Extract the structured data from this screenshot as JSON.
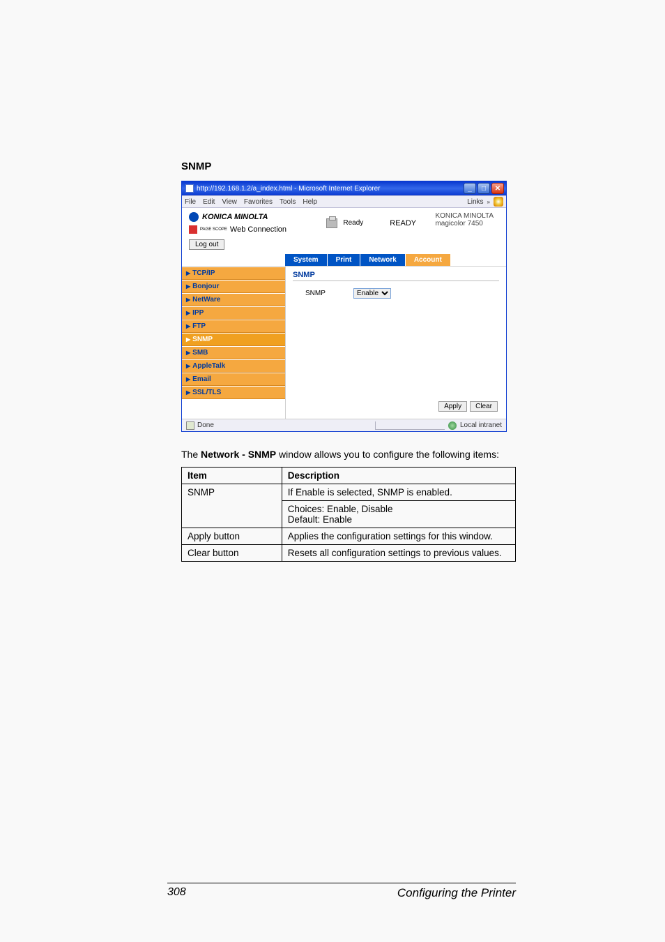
{
  "section_heading": "SNMP",
  "ie_window": {
    "title": "http://192.168.1.2/a_index.html - Microsoft Internet Explorer",
    "menubar": [
      "File",
      "Edit",
      "View",
      "Favorites",
      "Tools",
      "Help"
    ],
    "links_label": "Links",
    "brand": "KONICA MINOLTA",
    "webconn_prefix": "PAGE SCOPE",
    "webconn": "Web Connection",
    "status_ready": "Ready",
    "status_label": "READY",
    "device_brand": "KONICA MINOLTA",
    "device_model": "magicolor 7450",
    "logout": "Log out",
    "tabs": [
      "System",
      "Print",
      "Network",
      "Account"
    ],
    "sidebar": [
      "TCP/IP",
      "Bonjour",
      "NetWare",
      "IPP",
      "FTP",
      "SNMP",
      "SMB",
      "AppleTalk",
      "Email",
      "SSL/TLS"
    ],
    "pane_heading": "SNMP",
    "form_label": "SNMP",
    "form_select_value": "Enable",
    "apply": "Apply",
    "clear": "Clear",
    "status_done": "Done",
    "status_zone": "Local intranet"
  },
  "description_intro_prefix": "The ",
  "description_intro_bold": "Network - SNMP",
  "description_intro_suffix": " window allows you to configure the following items:",
  "desc_table": {
    "head": [
      "Item",
      "Description"
    ],
    "rows": [
      {
        "item": "SNMP",
        "desc_line1": "If Enable is selected, SNMP is enabled.",
        "desc_line2": "Choices: Enable, Disable",
        "desc_line3": "Default:  Enable"
      },
      {
        "item": "Apply button",
        "desc_line1": "Applies the configuration settings for this window."
      },
      {
        "item": "Clear button",
        "desc_line1": "Resets all configuration settings to previous values."
      }
    ]
  },
  "footer": {
    "page": "308",
    "title": "Configuring the Printer"
  }
}
